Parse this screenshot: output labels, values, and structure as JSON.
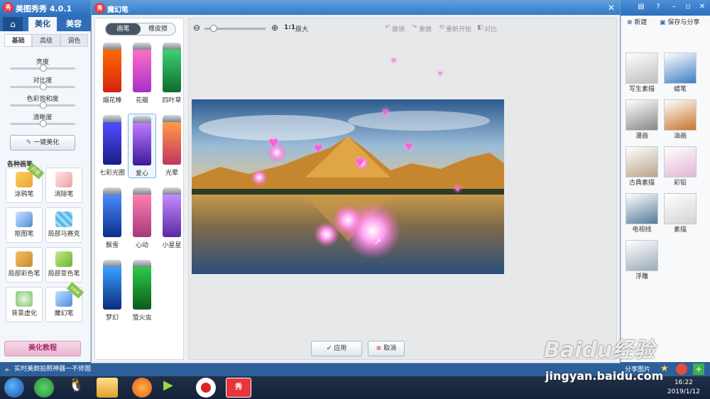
{
  "app": {
    "title": "美图秀秀 4.0.1",
    "logo_text": "秀"
  },
  "main_tabs": [
    {
      "label": "美化",
      "active": true
    },
    {
      "label": "美容",
      "active": false
    }
  ],
  "left": {
    "subtabs": [
      {
        "label": "基础",
        "active": true
      },
      {
        "label": "高级",
        "active": false
      },
      {
        "label": "调色",
        "active": false
      }
    ],
    "sliders": [
      {
        "label": "亮度",
        "value": 0.5
      },
      {
        "label": "对比度",
        "value": 0.5
      },
      {
        "label": "色彩饱和度",
        "value": 0.5
      },
      {
        "label": "清晰度",
        "value": 0.5
      }
    ],
    "one_click_label": "一键美化",
    "section_label": "各种画笔",
    "tools": [
      {
        "label": "涂鸦笔",
        "badge": "升级"
      },
      {
        "label": "消除笔",
        "badge": ""
      },
      {
        "label": "抠图笔",
        "badge": ""
      },
      {
        "label": "局部马赛克",
        "badge": ""
      },
      {
        "label": "局部彩色笔",
        "badge": ""
      },
      {
        "label": "局部变色笔",
        "badge": ""
      },
      {
        "label": "背景虚化",
        "badge": ""
      },
      {
        "label": "魔幻笔",
        "badge": "new"
      }
    ],
    "tutorial_label": "美化教程"
  },
  "statusbar": {
    "text": "实时美颜拍照神器一不修图"
  },
  "dialog": {
    "title": "魔幻笔",
    "close_glyph": "✕",
    "modes": [
      {
        "label": "画笔",
        "active": true
      },
      {
        "label": "橡皮擦",
        "active": false
      }
    ],
    "pens": [
      {
        "label": "烟花棒",
        "selected": false
      },
      {
        "label": "花瓣",
        "selected": false
      },
      {
        "label": "四叶草",
        "selected": false
      },
      {
        "label": "七彩光圈",
        "selected": false
      },
      {
        "label": "爱心",
        "selected": true
      },
      {
        "label": "光晕",
        "selected": false
      },
      {
        "label": "飘雪",
        "selected": false
      },
      {
        "label": "心动",
        "selected": false
      },
      {
        "label": "小星星",
        "selected": false
      },
      {
        "label": "梦幻",
        "selected": false
      },
      {
        "label": "萤火虫",
        "selected": false
      }
    ],
    "toolbar": {
      "zoom_label": "1:1",
      "original_label": "原大",
      "undo": "撤销",
      "redo": "重做",
      "restart": "重新开始",
      "compare": "对比",
      "zoom_level": 0.1
    },
    "apply_label": "应用",
    "cancel_label": "取消"
  },
  "right": {
    "new_label": "新建",
    "save_label": "保存与分享",
    "effects": [
      "写生素描",
      "蜡笔",
      "漫画",
      "油画",
      "古典素描",
      "彩铅",
      "电视线",
      "素描",
      "浮雕"
    ],
    "share_label": "分享图片"
  },
  "taskbar": {
    "time": "16:22",
    "date": "2019/1/12"
  },
  "watermark": {
    "brand": "Baidu经验",
    "url": "jingyan.baidu.com"
  },
  "colors": {
    "accent": "#2f6eb6",
    "dialog_title": "#347bc4",
    "taskbar": "#15223a"
  }
}
